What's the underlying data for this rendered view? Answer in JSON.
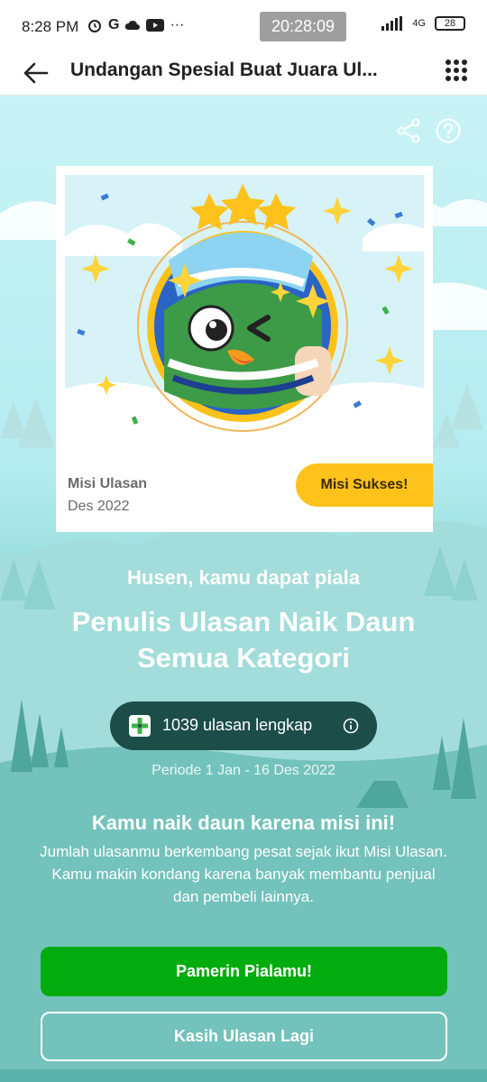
{
  "status_bar": {
    "time": "8:28 PM",
    "clock_badge": "20:28:09",
    "network": "4G",
    "battery": "28"
  },
  "app_bar": {
    "title": "Undangan Spesial Buat Juara Ul..."
  },
  "card": {
    "category": "Misi Ulasan",
    "date": "Des 2022",
    "status_badge": "Misi Sukses!"
  },
  "message": {
    "greeting": "Husen, kamu dapat piala",
    "trophy_name": "Penulis Ulasan Naik Daun Semua Kategori"
  },
  "stats": {
    "reviews_text": "1039 ulasan lengkap",
    "period": "Periode 1 Jan - 16 Des 2022"
  },
  "reason": {
    "title": "Kamu naik daun karena misi ini!",
    "body": "Jumlah ulasanmu berkembang pesat sejak ikut Misi Ulasan. Kamu makin kondang karena banyak membantu penjual dan pembeli lainnya."
  },
  "buttons": {
    "primary": "Pamerin Pialamu!",
    "secondary": "Kasih Ulasan Lagi"
  },
  "colors": {
    "primary_green": "#03ac0e",
    "badge_yellow": "#ffc21a",
    "pill_dark": "#1c4d48"
  }
}
